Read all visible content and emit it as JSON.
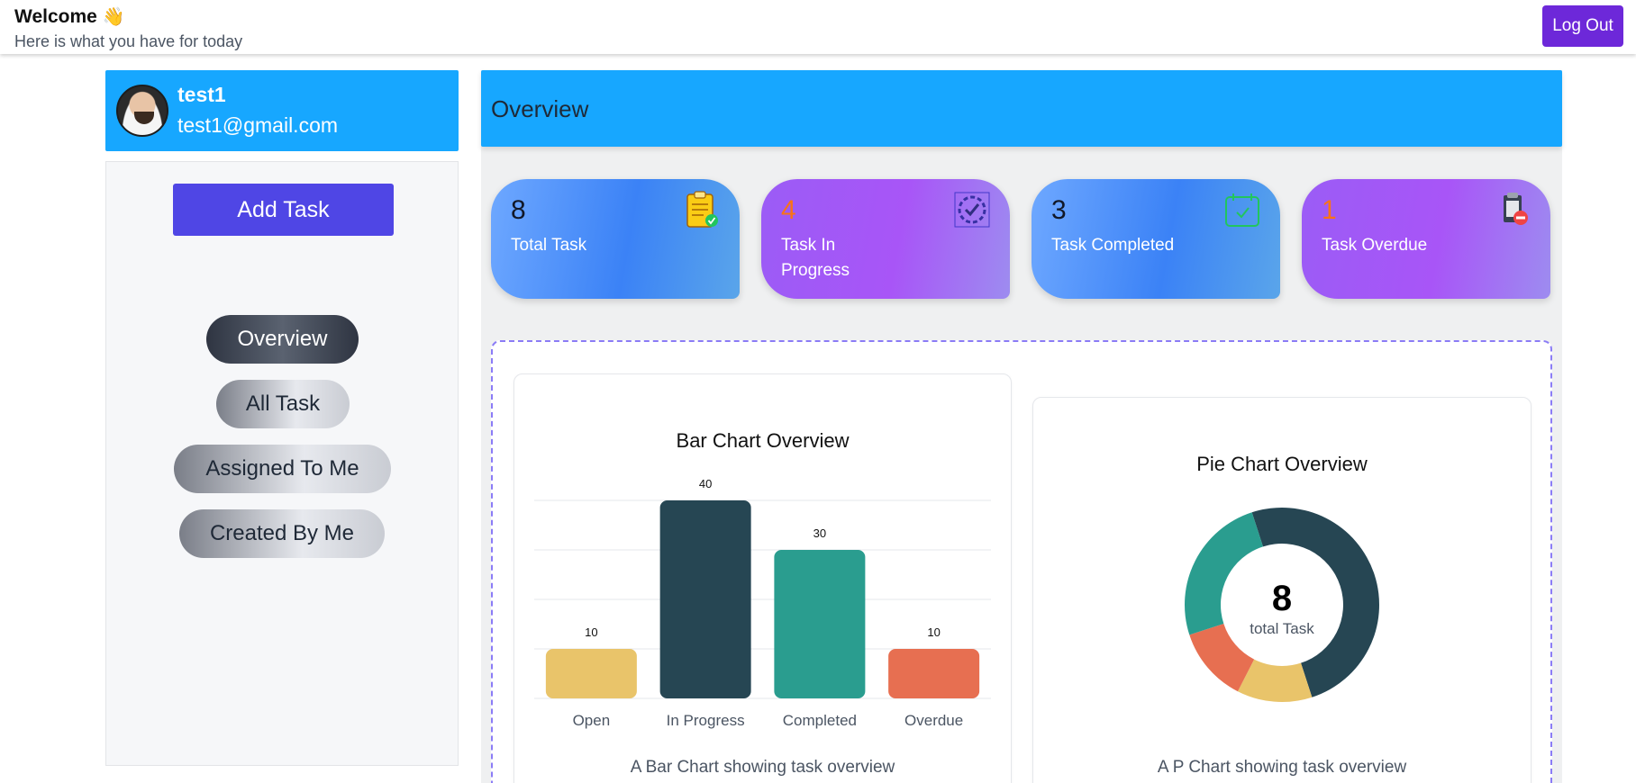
{
  "header": {
    "title": "Welcome",
    "title_emoji": "👋",
    "subtitle": "Here is what you have for today",
    "logout_label": "Log Out"
  },
  "profile": {
    "name": "test1",
    "email": "test1@gmail.com"
  },
  "sidebar": {
    "add_task_label": "Add Task",
    "nav": [
      {
        "label": "Overview",
        "active": true
      },
      {
        "label": "All Task",
        "active": false
      },
      {
        "label": "Assigned To Me",
        "active": false
      },
      {
        "label": "Created By Me",
        "active": false
      }
    ]
  },
  "main": {
    "title": "Overview",
    "stats": [
      {
        "value": "8",
        "label": "Total Task",
        "icon": "clipboard-check-icon"
      },
      {
        "value": "4",
        "label": "Task In Progress",
        "icon": "progress-check-icon"
      },
      {
        "value": "3",
        "label": "Task Completed",
        "icon": "calendar-check-icon"
      },
      {
        "value": "1",
        "label": "Task Overdue",
        "icon": "clipboard-blocked-icon"
      }
    ]
  },
  "colors": {
    "accent_blue": "#17a7ff",
    "accent_indigo": "#4f46e5",
    "logout_purple": "#6d28d9",
    "stat_number_orange": "#f97316",
    "open": "#e9c46a",
    "in_progress": "#264653",
    "completed": "#2a9d8f",
    "overdue": "#e76f51"
  },
  "bar_card": {
    "title": "Bar Chart Overview",
    "caption": "A Bar Chart showing task overview"
  },
  "pie_card": {
    "title": "Pie Chart Overview",
    "caption": "A P Chart showing task overview",
    "center_value": "8",
    "center_label": "total Task"
  },
  "chart_data": [
    {
      "type": "bar",
      "title": "Bar Chart Overview",
      "categories": [
        "Open",
        "In Progress",
        "Completed",
        "Overdue"
      ],
      "values": [
        10,
        40,
        30,
        10
      ],
      "value_labels": [
        "10",
        "40",
        "30",
        "10"
      ],
      "colors": [
        "#e9c46a",
        "#264653",
        "#2a9d8f",
        "#e76f51"
      ],
      "ylim": [
        0,
        40
      ],
      "grid": true
    },
    {
      "type": "pie",
      "title": "Pie Chart Overview",
      "categories": [
        "In Progress",
        "Open",
        "Overdue",
        "Completed"
      ],
      "values": [
        4,
        1,
        1,
        2
      ],
      "colors": [
        "#264653",
        "#e9c46a",
        "#e76f51",
        "#2a9d8f"
      ],
      "donut": true
    }
  ]
}
